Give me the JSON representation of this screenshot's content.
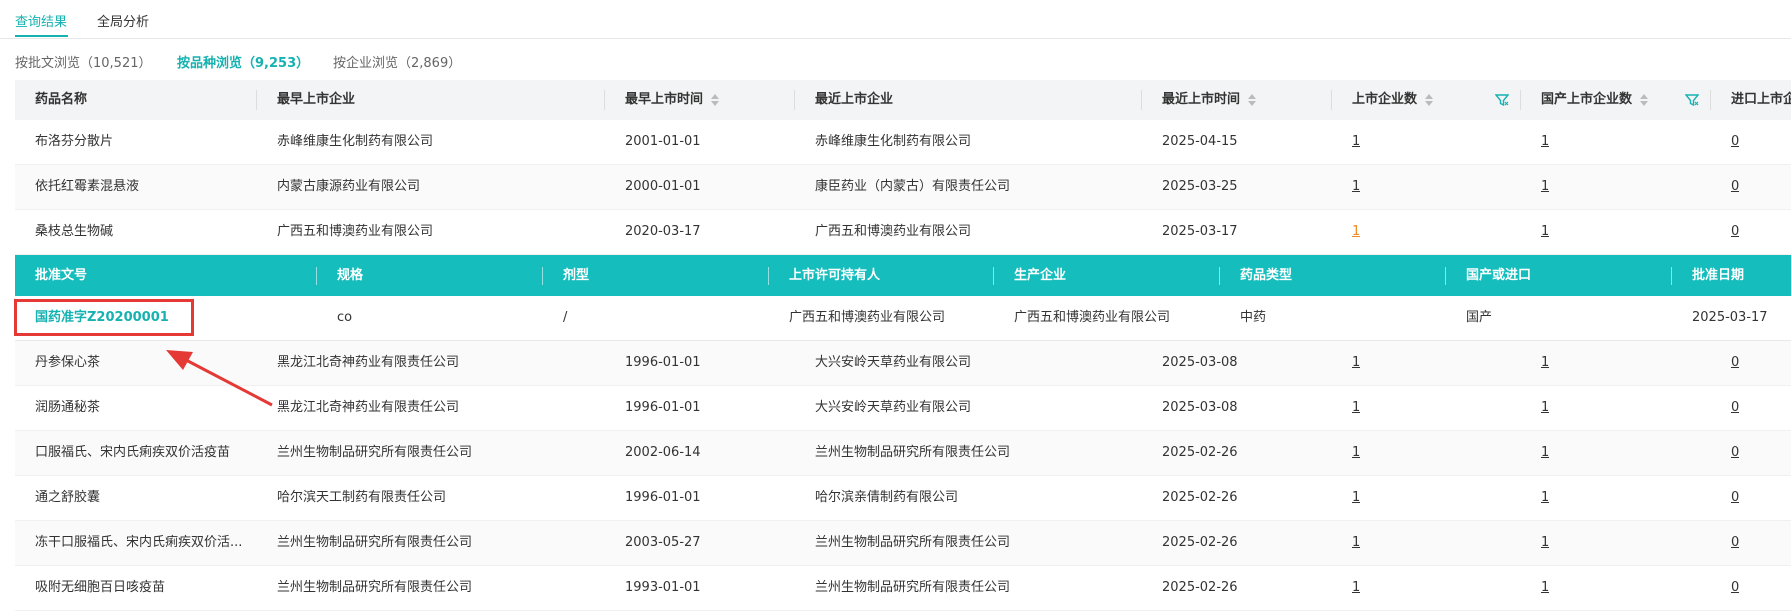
{
  "tabs": [
    {
      "label": "查询结果",
      "active": true
    },
    {
      "label": "全局分析",
      "active": false
    }
  ],
  "views": [
    {
      "label": "按批文浏览（10,521）",
      "active": false
    },
    {
      "label": "按品种浏览（9,253）",
      "active": true
    },
    {
      "label": "按企业浏览（2,869）",
      "active": false
    }
  ],
  "table": {
    "headers": {
      "drug_name": "药品名称",
      "earliest_company": "最早上市企业",
      "earliest_date": "最早上市时间",
      "latest_company": "最近上市企业",
      "latest_date": "最近上市时间",
      "company_count": "上市企业数",
      "domestic_count": "国产上市企业数",
      "import_count": "进口上市企"
    },
    "rows_top": [
      {
        "drug_name": "布洛芬分散片",
        "earliest_company": "赤峰维康生化制药有限公司",
        "earliest_date": "2001-01-01",
        "latest_company": "赤峰维康生化制药有限公司",
        "latest_date": "2025-04-15",
        "company_count": "1",
        "domestic_count": "1",
        "import_count": "0"
      },
      {
        "drug_name": "依托红霉素混悬液",
        "earliest_company": "内蒙古康源药业有限公司",
        "earliest_date": "2000-01-01",
        "latest_company": "康臣药业（内蒙古）有限责任公司",
        "latest_date": "2025-03-25",
        "company_count": "1",
        "domestic_count": "1",
        "import_count": "0"
      },
      {
        "drug_name": "桑枝总生物碱",
        "earliest_company": "广西五和博澳药业有限公司",
        "earliest_date": "2020-03-17",
        "latest_company": "广西五和博澳药业有限公司",
        "latest_date": "2025-03-17",
        "company_count": "1",
        "domestic_count": "1",
        "import_count": "0"
      }
    ],
    "rows_bottom": [
      {
        "drug_name": "丹参保心茶",
        "earliest_company": "黑龙江北奇神药业有限责任公司",
        "earliest_date": "1996-01-01",
        "latest_company": "大兴安岭天草药业有限公司",
        "latest_date": "2025-03-08",
        "company_count": "1",
        "domestic_count": "1",
        "import_count": "0"
      },
      {
        "drug_name": "润肠通秘茶",
        "earliest_company": "黑龙江北奇神药业有限责任公司",
        "earliest_date": "1996-01-01",
        "latest_company": "大兴安岭天草药业有限公司",
        "latest_date": "2025-03-08",
        "company_count": "1",
        "domestic_count": "1",
        "import_count": "0"
      },
      {
        "drug_name": "口服福氏、宋内氏痢疾双价活疫苗",
        "earliest_company": "兰州生物制品研究所有限责任公司",
        "earliest_date": "2002-06-14",
        "latest_company": "兰州生物制品研究所有限责任公司",
        "latest_date": "2025-02-26",
        "company_count": "1",
        "domestic_count": "1",
        "import_count": "0"
      },
      {
        "drug_name": "通之舒胶囊",
        "earliest_company": "哈尔滨天工制药有限责任公司",
        "earliest_date": "1996-01-01",
        "latest_company": "哈尔滨亲倩制药有限公司",
        "latest_date": "2025-02-26",
        "company_count": "1",
        "domestic_count": "1",
        "import_count": "0"
      },
      {
        "drug_name": "冻干口服福氏、宋内氏痢疾双价活...",
        "earliest_company": "兰州生物制品研究所有限责任公司",
        "earliest_date": "2003-05-27",
        "latest_company": "兰州生物制品研究所有限责任公司",
        "latest_date": "2025-02-26",
        "company_count": "1",
        "domestic_count": "1",
        "import_count": "0"
      },
      {
        "drug_name": "吸附无细胞百日咳疫苗",
        "earliest_company": "兰州生物制品研究所有限责任公司",
        "earliest_date": "1993-01-01",
        "latest_company": "兰州生物制品研究所有限责任公司",
        "latest_date": "2025-02-26",
        "company_count": "1",
        "domestic_count": "1",
        "import_count": "0"
      }
    ]
  },
  "sub_table": {
    "headers": {
      "approval_no": "批准文号",
      "spec": "规格",
      "dosage_form": "剂型",
      "holder": "上市许可持有人",
      "manufacturer": "生产企业",
      "drug_type": "药品类型",
      "origin": "国产或进口",
      "approval_date": "批准日期"
    },
    "row": {
      "approval_no": "国药准字Z20200001",
      "spec": "co",
      "dosage_form": "/",
      "holder": "广西五和博澳药业有限公司",
      "manufacturer": "广西五和博澳药业有限公司",
      "drug_type": "中药",
      "origin": "国产",
      "approval_date": "2025-03-17"
    }
  },
  "colors": {
    "accent": "#16b1b1",
    "sub_header_bg": "#15bdbd",
    "highlight_orange": "#f08a24",
    "annotation_red": "#e53935"
  }
}
